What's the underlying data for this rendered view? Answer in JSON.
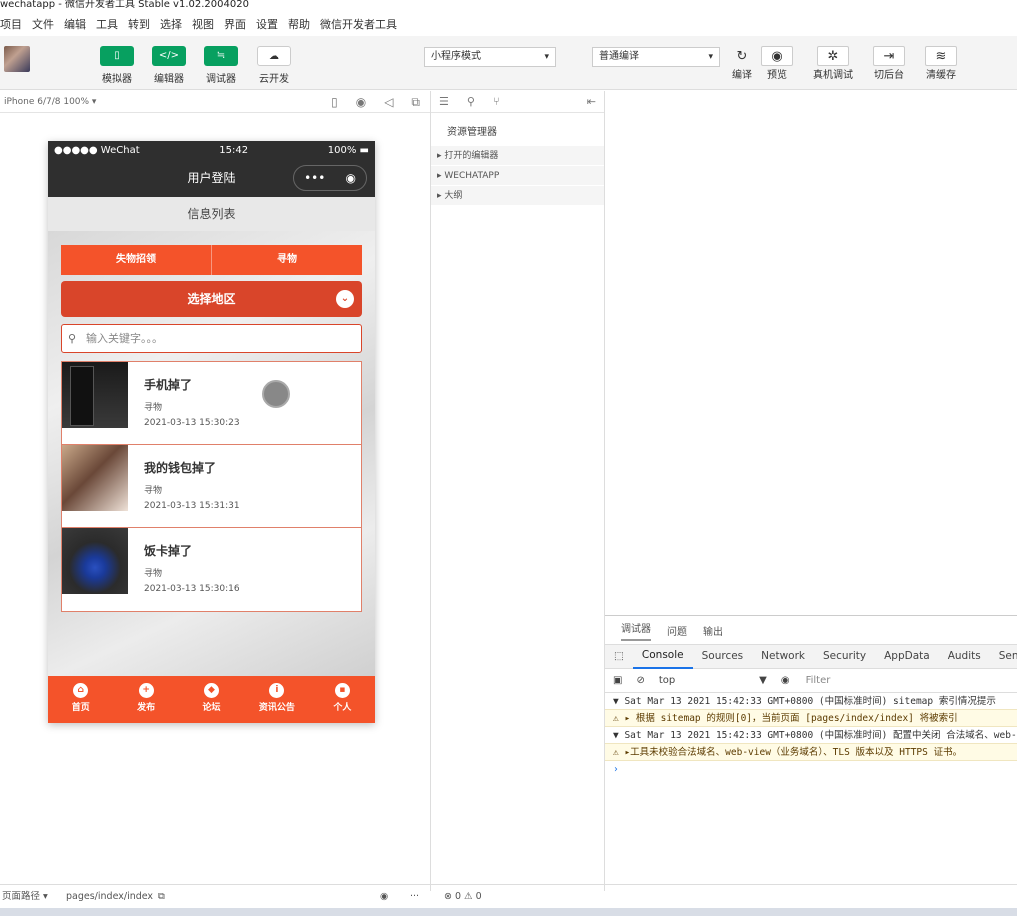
{
  "window": {
    "title": "wechatapp - 微信开发者工具 Stable v1.02.2004020"
  },
  "menu": [
    "项目",
    "文件",
    "编辑",
    "工具",
    "转到",
    "选择",
    "视图",
    "界面",
    "设置",
    "帮助",
    "微信开发者工具"
  ],
  "toolbar": {
    "left_buttons": [
      {
        "icon": "▯",
        "label": "模拟器"
      },
      {
        "icon": "</>",
        "label": "编辑器"
      },
      {
        "icon": "≒",
        "label": "调试器"
      },
      {
        "icon": "☁",
        "label": "云开发"
      }
    ],
    "mode_select": "小程序模式",
    "compile_select": "普通编译",
    "right_buttons": [
      {
        "icon": "↻",
        "label": "编译"
      },
      {
        "icon": "◉",
        "label": "预览"
      },
      {
        "icon": "✲",
        "label": "真机调试"
      },
      {
        "icon": "⇥",
        "label": "切后台"
      },
      {
        "icon": "≋",
        "label": "清缓存"
      }
    ]
  },
  "simulator": {
    "device": "iPhone 6/7/8 100% ▾"
  },
  "phone": {
    "carrier": "●●●●● WeChat",
    "time": "15:42",
    "battery": "100%",
    "nav_title": "用户登陆",
    "capsule_more": "•••",
    "capsule_close": "◉",
    "page_header": "信息列表",
    "tabs": [
      "失物招领",
      "寻物"
    ],
    "region_label": "选择地区",
    "region_chevron": "⌄",
    "search_placeholder": "输入关键字。。。",
    "items": [
      {
        "title": "手机掉了",
        "category": "寻物",
        "date": "2021-03-13 15:30:23"
      },
      {
        "title": "我的钱包掉了",
        "category": "寻物",
        "date": "2021-03-13 15:31:31"
      },
      {
        "title": "饭卡掉了",
        "category": "寻物",
        "date": "2021-03-13 15:30:16"
      }
    ],
    "tabbar": [
      {
        "icon": "⌂",
        "label": "首页"
      },
      {
        "icon": "+",
        "label": "发布"
      },
      {
        "icon": "◆",
        "label": "论坛"
      },
      {
        "icon": "i",
        "label": "资讯公告"
      },
      {
        "icon": "▪",
        "label": "个人"
      }
    ]
  },
  "explorer": {
    "title": "资源管理器",
    "sections": [
      "▸ 打开的编辑器",
      "▸ WECHATAPP",
      "▸ 大纲"
    ]
  },
  "debugger": {
    "top_tabs": [
      "调试器",
      "问题",
      "输出"
    ],
    "tabs": [
      "Console",
      "Sources",
      "Network",
      "Security",
      "AppData",
      "Audits",
      "Sensor"
    ],
    "context": "top",
    "filter_placeholder": "Filter",
    "logs": [
      {
        "type": "group",
        "text": "▼ Sat Mar 13 2021 15:42:33 GMT+0800 (中国标准时间) sitemap 索引情况提示"
      },
      {
        "type": "warn",
        "text": "⚠ ▸ 根据 sitemap 的规则[0]，当前页面 [pages/index/index] 将被索引"
      },
      {
        "type": "group",
        "text": "▼ Sat Mar 13 2021 15:42:33 GMT+0800 (中国标准时间) 配置中关闭 合法域名、web-view"
      },
      {
        "type": "warn",
        "text": "⚠ ▸工具未校验合法域名、web-view（业务域名）、TLS 版本以及 HTTPS 证书。"
      },
      {
        "type": "prompt",
        "text": "›"
      }
    ]
  },
  "statusbar": {
    "path_label": "页面路径 ▾",
    "path": "pages/index/index",
    "errors": "⊗ 0 ⚠ 0"
  }
}
